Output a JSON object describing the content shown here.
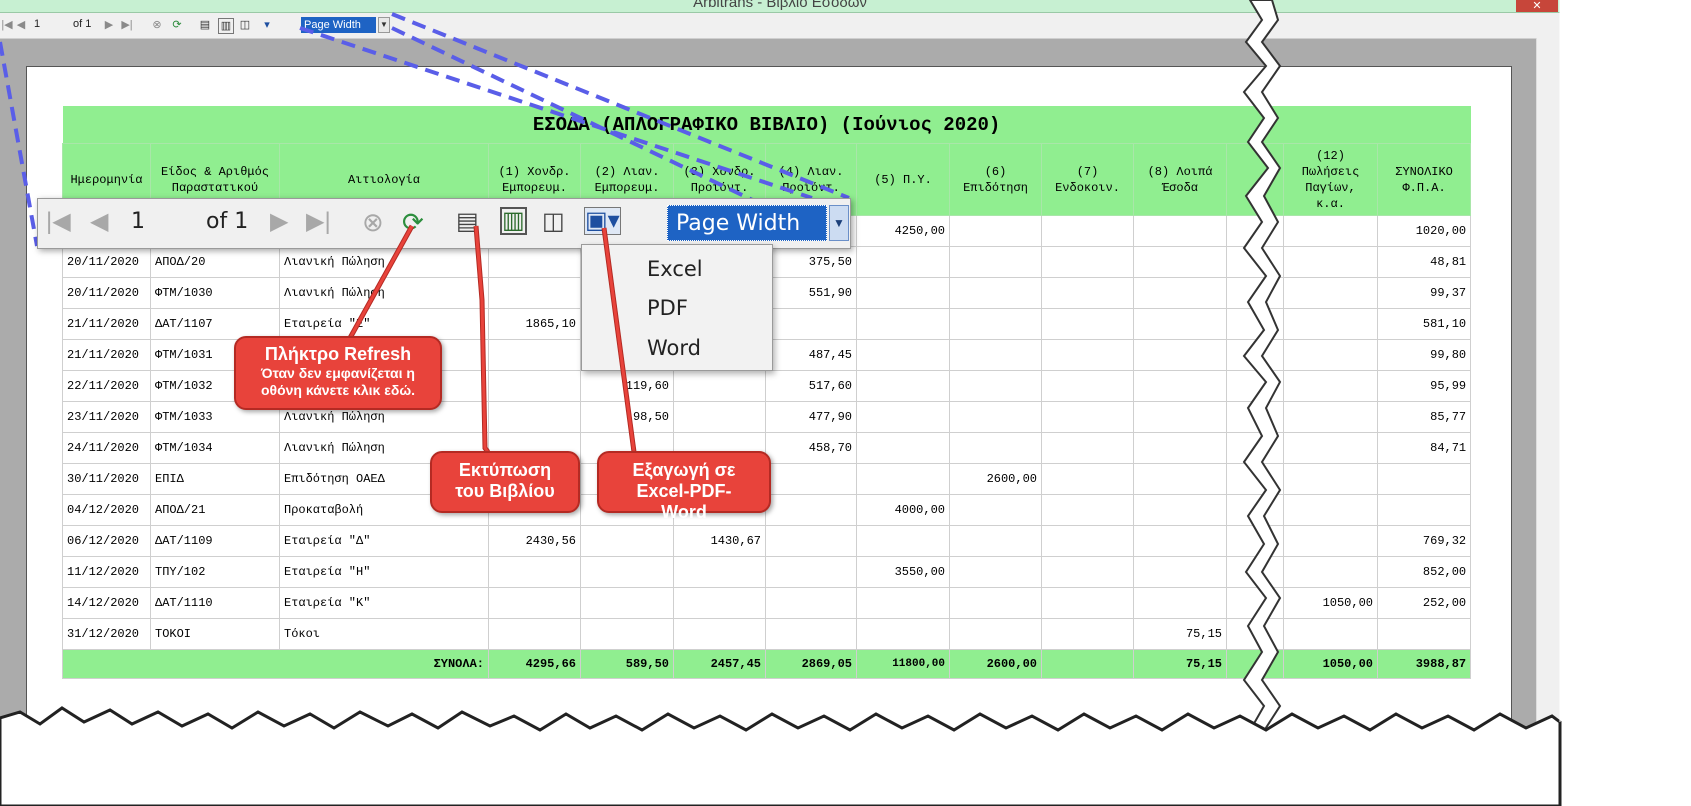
{
  "window": {
    "title": "Arbitrans - Βιβλίο Εσόδων",
    "close": "✕"
  },
  "toolbar": {
    "page": "1",
    "of": "of 1",
    "zoom": "Page Width"
  },
  "big_toolbar": {
    "page": "1",
    "of": "of 1",
    "zoom": "Page Width"
  },
  "export_menu": {
    "items": [
      "Excel",
      "PDF",
      "Word"
    ]
  },
  "report": {
    "title": "ΕΣΟΔΑ (ΑΠΛΟΓΡΑΦΙΚΟ ΒΙΒΛΙΟ) (Ιούνιος 2020)",
    "headers": [
      "Ημερομηνία",
      "Είδος & Αριθμός Παραστατικού",
      "Αιτιολογία",
      "(1) Χονδρ. Εμπορευμ.",
      "(2) Λιαν. Εμπορευμ.",
      "(3) Χονδρ. Προϊόντ.",
      "(4) Λιαν. Προϊόντ.",
      "(5) Π.Υ.",
      "(6) Επιδότηση",
      "(7) Ενδοκοιν.",
      "(8) Λοιπά Έσοδα",
      "",
      "(12) Πωλήσεις Παγίων, κ.α.",
      "ΣΥΝΟΛΙΚΟ Φ.Π.Α."
    ],
    "rows": [
      [
        "",
        "",
        "",
        "",
        "",
        "",
        "",
        "4250,00",
        "",
        "",
        "",
        "",
        "",
        "1020,00"
      ],
      [
        "20/11/2020",
        "ΑΠΟΔ/20",
        "Λιανική Πώληση",
        "",
        "",
        "",
        "375,50",
        "",
        "",
        "",
        "",
        "",
        "",
        "48,81"
      ],
      [
        "20/11/2020",
        "ΦΤΜ/1030",
        "Λιανική Πώληση",
        "",
        "",
        "",
        "551,90",
        "",
        "",
        "",
        "",
        "",
        "",
        "99,37"
      ],
      [
        "21/11/2020",
        "ΔΑΤ/1107",
        "Εταιρεία \"Ε\"",
        "1865,10",
        "",
        "",
        "",
        "",
        "",
        "",
        "",
        "",
        "",
        "581,10"
      ],
      [
        "21/11/2020",
        "ΦΤΜ/1031",
        "",
        "",
        "",
        "",
        "487,45",
        "",
        "",
        "",
        "",
        "",
        "",
        "99,80"
      ],
      [
        "22/11/2020",
        "ΦΤΜ/1032",
        "",
        "",
        "119,60",
        "",
        "517,60",
        "",
        "",
        "",
        "",
        "",
        "",
        "95,99"
      ],
      [
        "23/11/2020",
        "ΦΤΜ/1033",
        "Λιανική Πώληση",
        "",
        "98,50",
        "",
        "477,90",
        "",
        "",
        "",
        "",
        "",
        "",
        "85,77"
      ],
      [
        "24/11/2020",
        "ΦΤΜ/1034",
        "Λιανική Πώληση",
        "",
        "",
        "",
        "458,70",
        "",
        "",
        "",
        "",
        "",
        "",
        "84,71"
      ],
      [
        "30/11/2020",
        "ΕΠΙΔ",
        "Επιδότηση ΟΑΕΔ",
        "",
        "",
        "",
        "",
        "",
        "2600,00",
        "",
        "",
        "",
        "",
        ""
      ],
      [
        "04/12/2020",
        "ΑΠΟΔ/21",
        "Προκαταβολή",
        "",
        "",
        "",
        "",
        "4000,00",
        "",
        "",
        "",
        "",
        "",
        ""
      ],
      [
        "06/12/2020",
        "ΔΑΤ/1109",
        "Εταιρεία \"Δ\"",
        "2430,56",
        "",
        "1430,67",
        "",
        "",
        "",
        "",
        "",
        "",
        "",
        "769,32"
      ],
      [
        "11/12/2020",
        "ΤΠΥ/102",
        "Εταιρεία \"Η\"",
        "",
        "",
        "",
        "",
        "3550,00",
        "",
        "",
        "",
        "",
        "",
        "852,00"
      ],
      [
        "14/12/2020",
        "ΔΑΤ/1110",
        "Εταιρεία \"Κ\"",
        "",
        "",
        "",
        "",
        "",
        "",
        "",
        "",
        "",
        "1050,00",
        "252,00"
      ],
      [
        "31/12/2020",
        "ΤΟΚΟΙ",
        "Τόκοι",
        "",
        "",
        "",
        "",
        "",
        "",
        "",
        "75,15",
        "",
        "",
        ""
      ]
    ],
    "totals_label": "ΣΥΝΟΛΑ:",
    "totals": [
      "4295,66",
      "589,50",
      "2457,45",
      "2869,05",
      "11800,00",
      "2600,00",
      "",
      "75,15",
      "",
      "1050,00",
      "3988,87"
    ]
  },
  "callouts": {
    "refresh_title": "Πλήκτρο Refresh",
    "refresh_text": "Όταν δεν εμφανίζεται η οθόνη κάνετε κλικ εδώ.",
    "print_text": "Εκτύπωση του Βιβλίου",
    "export_text": "Εξαγωγή σε Excel-PDF-Word"
  },
  "colors": {
    "header_bg": "#90ee90",
    "callout": "#e8433b",
    "selection": "#1e63c4"
  }
}
